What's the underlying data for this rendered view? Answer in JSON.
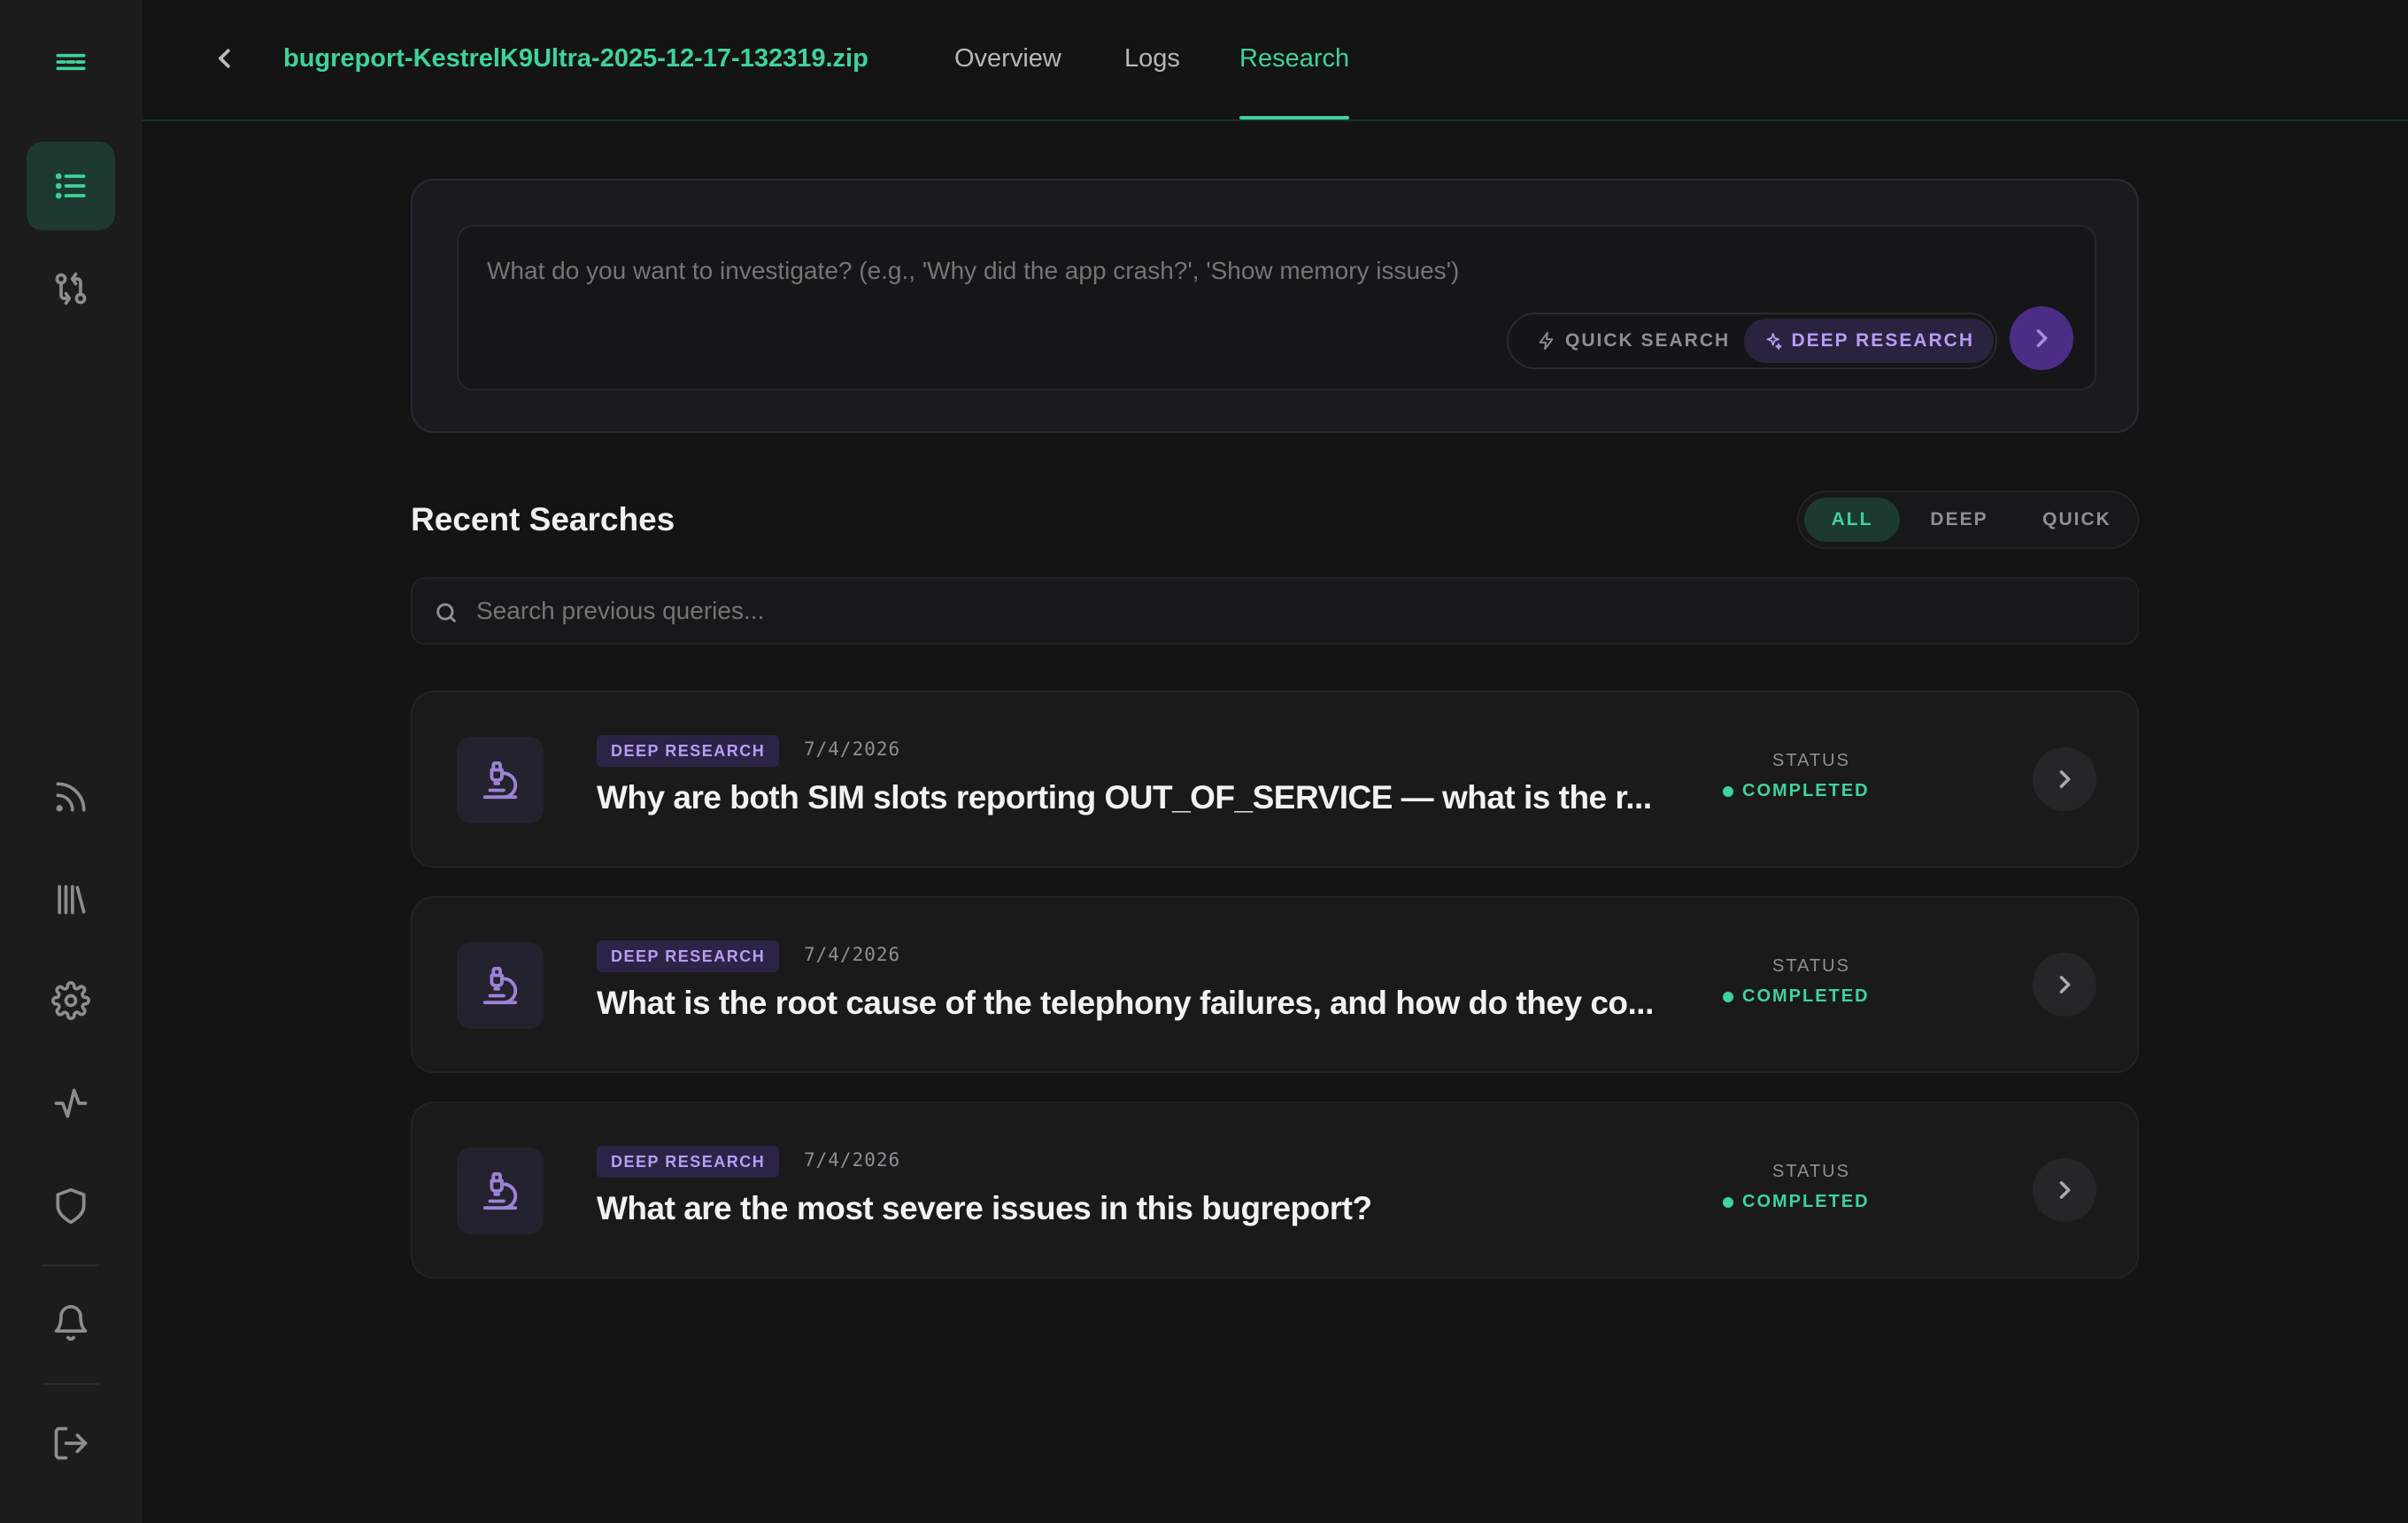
{
  "sidebar": {
    "items": [
      {
        "icon": "menu-logo-icon"
      },
      {
        "icon": "list-icon",
        "active": true
      },
      {
        "icon": "git-compare-icon"
      },
      {
        "icon": "rss-icon"
      },
      {
        "icon": "library-icon"
      },
      {
        "icon": "gear-icon"
      },
      {
        "icon": "activity-icon"
      },
      {
        "icon": "shield-icon"
      },
      {
        "icon": "bell-icon"
      },
      {
        "icon": "logout-icon"
      }
    ]
  },
  "header": {
    "file_name": "bugreport-KestrelK9Ultra-2025-12-17-132319.zip",
    "tabs": [
      {
        "label": "Overview"
      },
      {
        "label": "Logs"
      },
      {
        "label": "Research",
        "active": true
      }
    ]
  },
  "query": {
    "placeholder": "What do you want to investigate? (e.g., 'Why did the app crash?', 'Show memory issues')",
    "quick_label": "QUICK SEARCH",
    "deep_label": "DEEP RESEARCH",
    "selected_mode": "DEEP RESEARCH"
  },
  "recent": {
    "title": "Recent Searches",
    "filters": [
      {
        "label": "ALL",
        "active": true
      },
      {
        "label": "DEEP"
      },
      {
        "label": "QUICK"
      }
    ],
    "search_placeholder": "Search previous queries...",
    "items": [
      {
        "badge": "DEEP RESEARCH",
        "date": "7/4/2026",
        "title": "Why are both SIM slots reporting OUT_OF_SERVICE — what is the r...",
        "status_label": "STATUS",
        "status": "COMPLETED"
      },
      {
        "badge": "DEEP RESEARCH",
        "date": "7/4/2026",
        "title": "What is the root cause of the telephony failures, and how do they co...",
        "status_label": "STATUS",
        "status": "COMPLETED"
      },
      {
        "badge": "DEEP RESEARCH",
        "date": "7/4/2026",
        "title": "What are the most severe issues in this bugreport?",
        "status_label": "STATUS",
        "status": "COMPLETED"
      }
    ]
  },
  "colors": {
    "accent": "#3fd39a",
    "deep_accent": "#b79cf5",
    "background": "#141414",
    "sidebar": "#1c1c1c"
  }
}
